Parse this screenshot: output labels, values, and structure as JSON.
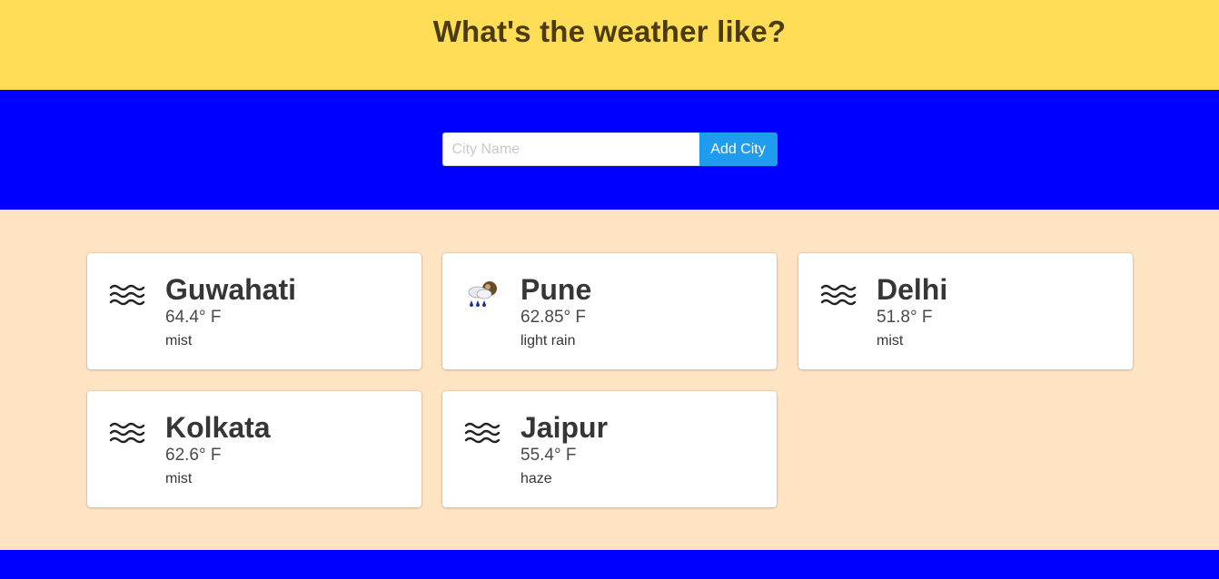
{
  "header": {
    "title": "What's the weather like?"
  },
  "search": {
    "placeholder": "City Name",
    "value": "",
    "button_label": "Add City"
  },
  "cities": [
    {
      "name": "Guwahati",
      "temp": "64.4° F",
      "desc": "mist",
      "icon": "mist-icon"
    },
    {
      "name": "Pune",
      "temp": "62.85° F",
      "desc": "light rain",
      "icon": "rain-cloud-icon"
    },
    {
      "name": "Delhi",
      "temp": "51.8° F",
      "desc": "mist",
      "icon": "mist-icon"
    },
    {
      "name": "Kolkata",
      "temp": "62.6° F",
      "desc": "mist",
      "icon": "mist-icon"
    },
    {
      "name": "Jaipur",
      "temp": "55.4° F",
      "desc": "haze",
      "icon": "mist-icon"
    }
  ],
  "colors": {
    "hero": "#ffdd57",
    "band": "#0000ff",
    "body": "#ffe4c4",
    "button": "#209cee"
  }
}
